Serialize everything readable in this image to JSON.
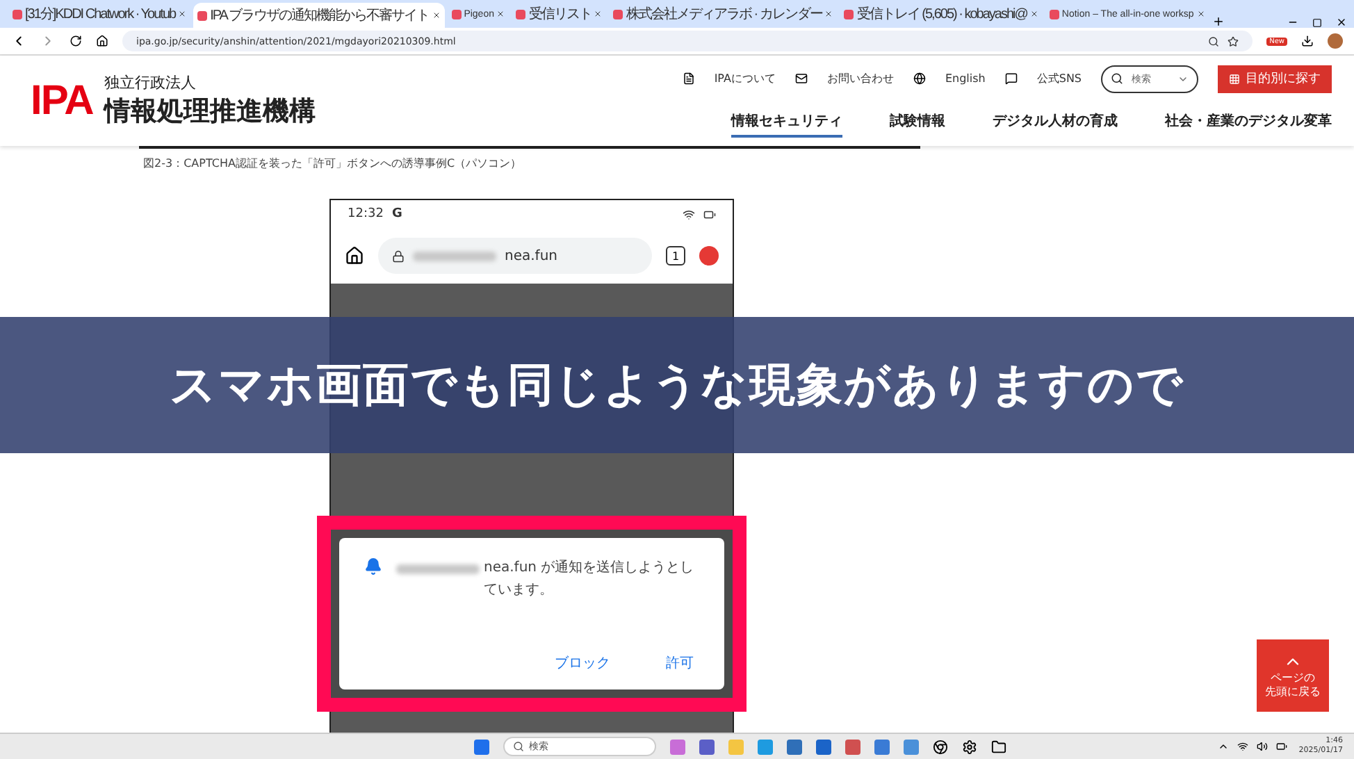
{
  "browser": {
    "tabs": [
      {
        "title": "[31分]KDDI Chatwork · Youtub",
        "selected": false
      },
      {
        "title": "IPA ブラウザの通知機能から不審サイト",
        "selected": true
      },
      {
        "title": "Pigeon",
        "selected": false
      },
      {
        "title": "受信リスト",
        "selected": false
      },
      {
        "title": "株式会社メディアラボ · カレンダー",
        "selected": false
      },
      {
        "title": "受信トレイ (5,605) · kobayashi@",
        "selected": false
      },
      {
        "title": "Notion – The all-in-one worksp",
        "selected": false
      }
    ],
    "url": "ipa.go.jp/security/anshin/attention/2021/mgdayori20210309.html",
    "badge": "New"
  },
  "site": {
    "logo": "IPA",
    "org_small": "独立行政法人",
    "org_name": "情報処理推進機構",
    "utility_links": [
      {
        "label": "IPAについて"
      },
      {
        "label": "お問い合わせ"
      },
      {
        "label": "English"
      },
      {
        "label": "公式SNS"
      }
    ],
    "search_placeholder": "検索",
    "purpose_button": "目的別に探す",
    "nav": [
      {
        "label": "情報セキュリティ",
        "selected": true
      },
      {
        "label": "試験情報",
        "selected": false
      },
      {
        "label": "デジタル人材の育成",
        "selected": false
      },
      {
        "label": "社会・産業のデジタル変革",
        "selected": false
      }
    ]
  },
  "figure_caption": "図2-3：CAPTCHA認証を装った「許可」ボタンへの誘導事例C（パソコン）",
  "phone": {
    "time": "12:32",
    "status_letter": "G",
    "url_domain": "nea.fun",
    "tab_count": "1",
    "notification": {
      "domain": "nea.fun",
      "message": "が通知を送信しようとしています。",
      "buttons": [
        "ブロック",
        "許可"
      ]
    }
  },
  "subtitle": "スマホ画面でも同じような現象がありますので",
  "back_to_top": [
    "ページの",
    "先頭に戻る"
  ],
  "taskbar": {
    "search_placeholder": "検索",
    "time": "1:46",
    "date": "2025/01/17"
  }
}
